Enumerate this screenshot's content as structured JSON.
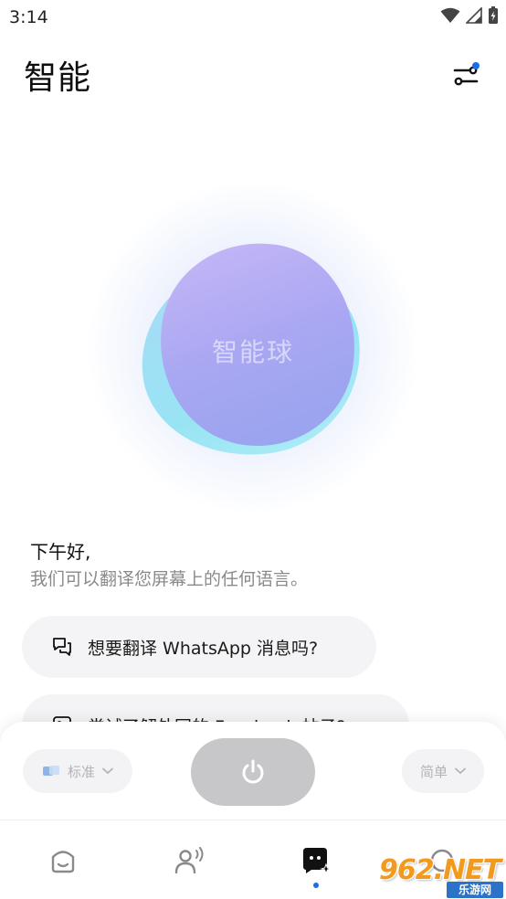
{
  "status_bar": {
    "time": "3:14"
  },
  "header": {
    "title": "智能"
  },
  "orb": {
    "label": "智能球"
  },
  "greeting": {
    "title": "下午好,",
    "subtitle": "我们可以翻译您屏幕上的任何语言。"
  },
  "suggestions": [
    {
      "text": "想要翻译 WhatsApp 消息吗?",
      "icon": "chat-bubbles-icon"
    },
    {
      "text": "尝试了解外国的 Facebook 帖子?",
      "icon": "image-icon"
    }
  ],
  "controls": {
    "mode_left": "标准",
    "mode_right": "简单",
    "power_icon": "power-icon"
  },
  "nav": {
    "items": [
      "face-icon",
      "voice-person-icon",
      "smart-ball-icon",
      "round-icon"
    ],
    "active_index": 2
  },
  "watermark": {
    "logo": "962.NET",
    "sub": "乐游网"
  },
  "colors": {
    "accent": "#1b6ce8",
    "orb_purple": "#a9a7f2",
    "orb_blue": "#8fe2f3",
    "power_button": "#c7c7c9"
  }
}
